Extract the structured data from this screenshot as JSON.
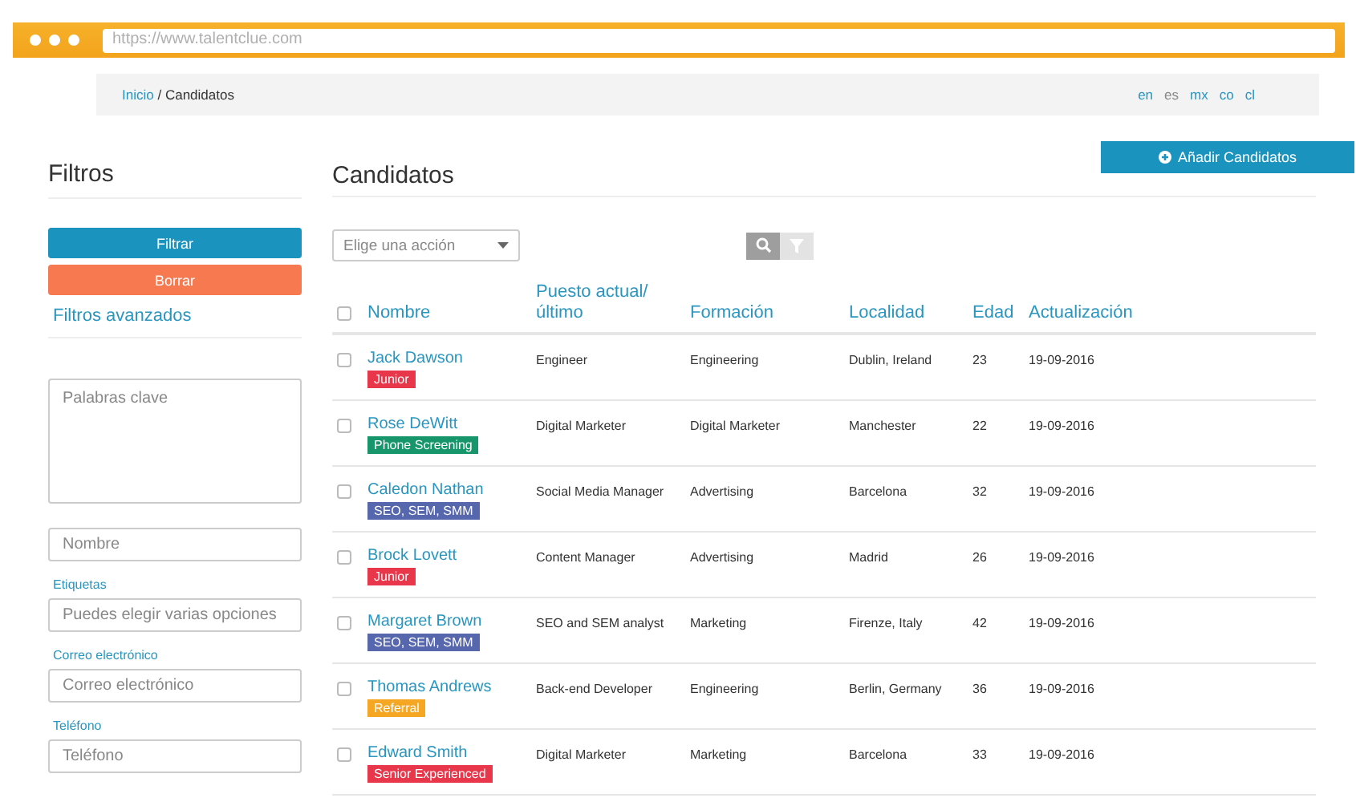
{
  "browser": {
    "url": "https://www.talentclue.com"
  },
  "breadcrumb": {
    "home": "Inicio",
    "separator": "/",
    "current": "Candidatos"
  },
  "languages": [
    {
      "label": "en",
      "selected": false
    },
    {
      "label": "es",
      "selected": true
    },
    {
      "label": "mx",
      "selected": false
    },
    {
      "label": "co",
      "selected": false
    },
    {
      "label": "cl",
      "selected": false
    }
  ],
  "sidebar": {
    "title": "Filtros",
    "filter_button": "Filtrar",
    "clear_button": "Borrar",
    "advanced_title": "Filtros avanzados",
    "fields": [
      {
        "kind": "textarea",
        "placeholder": "Palabras clave"
      },
      {
        "kind": "input",
        "placeholder": "Nombre"
      },
      {
        "kind": "input",
        "label": "Etiquetas",
        "placeholder": "Puedes elegir varias opciones"
      },
      {
        "kind": "input",
        "label": "Correo electrónico",
        "placeholder": "Correo electrónico"
      },
      {
        "kind": "input",
        "label": "Teléfono",
        "placeholder": "Teléfono"
      }
    ]
  },
  "main": {
    "title": "Candidatos",
    "add_button": "Añadir Candidatos",
    "action_select": "Elige una acción"
  },
  "table": {
    "select_all_checked": false,
    "columns": [
      "Nombre",
      "Puesto actual/ último",
      "Formación",
      "Localidad",
      "Edad",
      "Actualización"
    ],
    "rows": [
      {
        "checked": false,
        "name": "Jack Dawson",
        "tag": {
          "label": "Junior",
          "color": "#e8364a"
        },
        "position": "Engineer",
        "education": "Engineering",
        "location": "Dublin, Ireland",
        "age": "23",
        "updated": "19-09-2016"
      },
      {
        "checked": false,
        "name": "Rose DeWitt",
        "tag": {
          "label": "Phone Screening",
          "color": "#16966a"
        },
        "position": "Digital Marketer",
        "education": "Digital Marketer",
        "location": "Manchester",
        "age": "22",
        "updated": "19-09-2016"
      },
      {
        "checked": false,
        "name": "Caledon Nathan",
        "tag": {
          "label": "SEO, SEM, SMM",
          "color": "#5767ad"
        },
        "position": "Social Media Manager",
        "education": "Advertising",
        "location": "Barcelona",
        "age": "32",
        "updated": "19-09-2016"
      },
      {
        "checked": false,
        "name": "Brock Lovett",
        "tag": {
          "label": "Junior",
          "color": "#e8364a"
        },
        "position": "Content Manager",
        "education": "Advertising",
        "location": "Madrid",
        "age": "26",
        "updated": "19-09-2016"
      },
      {
        "checked": false,
        "name": "Margaret Brown",
        "tag": {
          "label": "SEO, SEM, SMM",
          "color": "#5767ad"
        },
        "position": "SEO and SEM analyst",
        "education": "Marketing",
        "location": "Firenze, Italy",
        "age": "42",
        "updated": "19-09-2016"
      },
      {
        "checked": false,
        "name": "Thomas Andrews",
        "tag": {
          "label": "Referral",
          "color": "#f5a623"
        },
        "position": "Back-end Developer",
        "education": "Engineering",
        "location": "Berlin, Germany",
        "age": "36",
        "updated": "19-09-2016"
      },
      {
        "checked": false,
        "name": "Edward Smith",
        "tag": {
          "label": "Senior Experienced",
          "color": "#e8364a"
        },
        "position": "Digital Marketer",
        "education": "Marketing",
        "location": "Barcelona",
        "age": "33",
        "updated": "19-09-2016"
      }
    ]
  }
}
